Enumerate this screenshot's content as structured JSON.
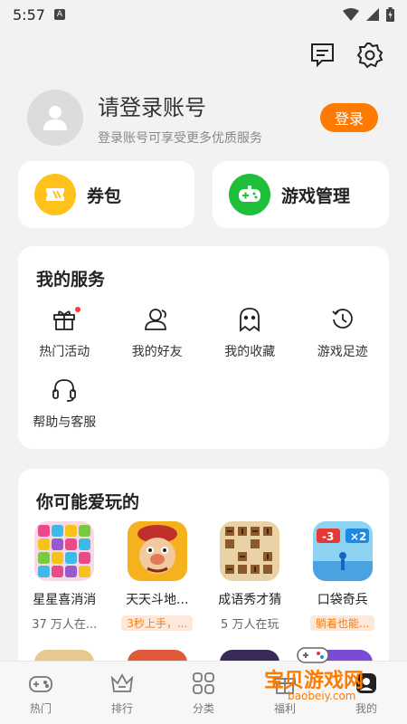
{
  "status_bar": {
    "time": "5:57",
    "badge": "A"
  },
  "profile": {
    "title": "请登录账号",
    "subtitle": "登录账号可享受更多优质服务",
    "login_label": "登录"
  },
  "quick": [
    {
      "label": "券包",
      "color": "#ffc21a",
      "icon": "ticket-icon"
    },
    {
      "label": "游戏管理",
      "color": "#1fbf3c",
      "icon": "gamepad-icon"
    }
  ],
  "services": {
    "title": "我的服务",
    "items": [
      {
        "label": "热门活动",
        "icon": "gift-icon"
      },
      {
        "label": "我的好友",
        "icon": "friends-icon"
      },
      {
        "label": "我的收藏",
        "icon": "ghost-icon"
      },
      {
        "label": "游戏足迹",
        "icon": "history-icon"
      },
      {
        "label": "帮助与客服",
        "icon": "headset-icon"
      }
    ]
  },
  "games": {
    "title": "你可能爱玩的",
    "items": [
      {
        "name": "星星喜消消",
        "sub": "37 万人在..."
      },
      {
        "name": "天天斗地...",
        "tag": "3秒上手，..."
      },
      {
        "name": "成语秀才猜",
        "sub": "5 万人在玩"
      },
      {
        "name": "口袋奇兵",
        "tag": "躺着也能..."
      }
    ]
  },
  "tabs": [
    {
      "label": "热门",
      "icon": "gamepad-icon"
    },
    {
      "label": "排行",
      "icon": "crown-icon"
    },
    {
      "label": "分类",
      "icon": "grid-icon"
    },
    {
      "label": "福利",
      "icon": "gift-icon"
    },
    {
      "label": "我的",
      "icon": "user-icon"
    }
  ],
  "watermark": {
    "text": "宝贝游戏网",
    "url": "baobeiy.com"
  },
  "colors": {
    "accent": "#ff7a00",
    "background": "#f2f2f2"
  }
}
